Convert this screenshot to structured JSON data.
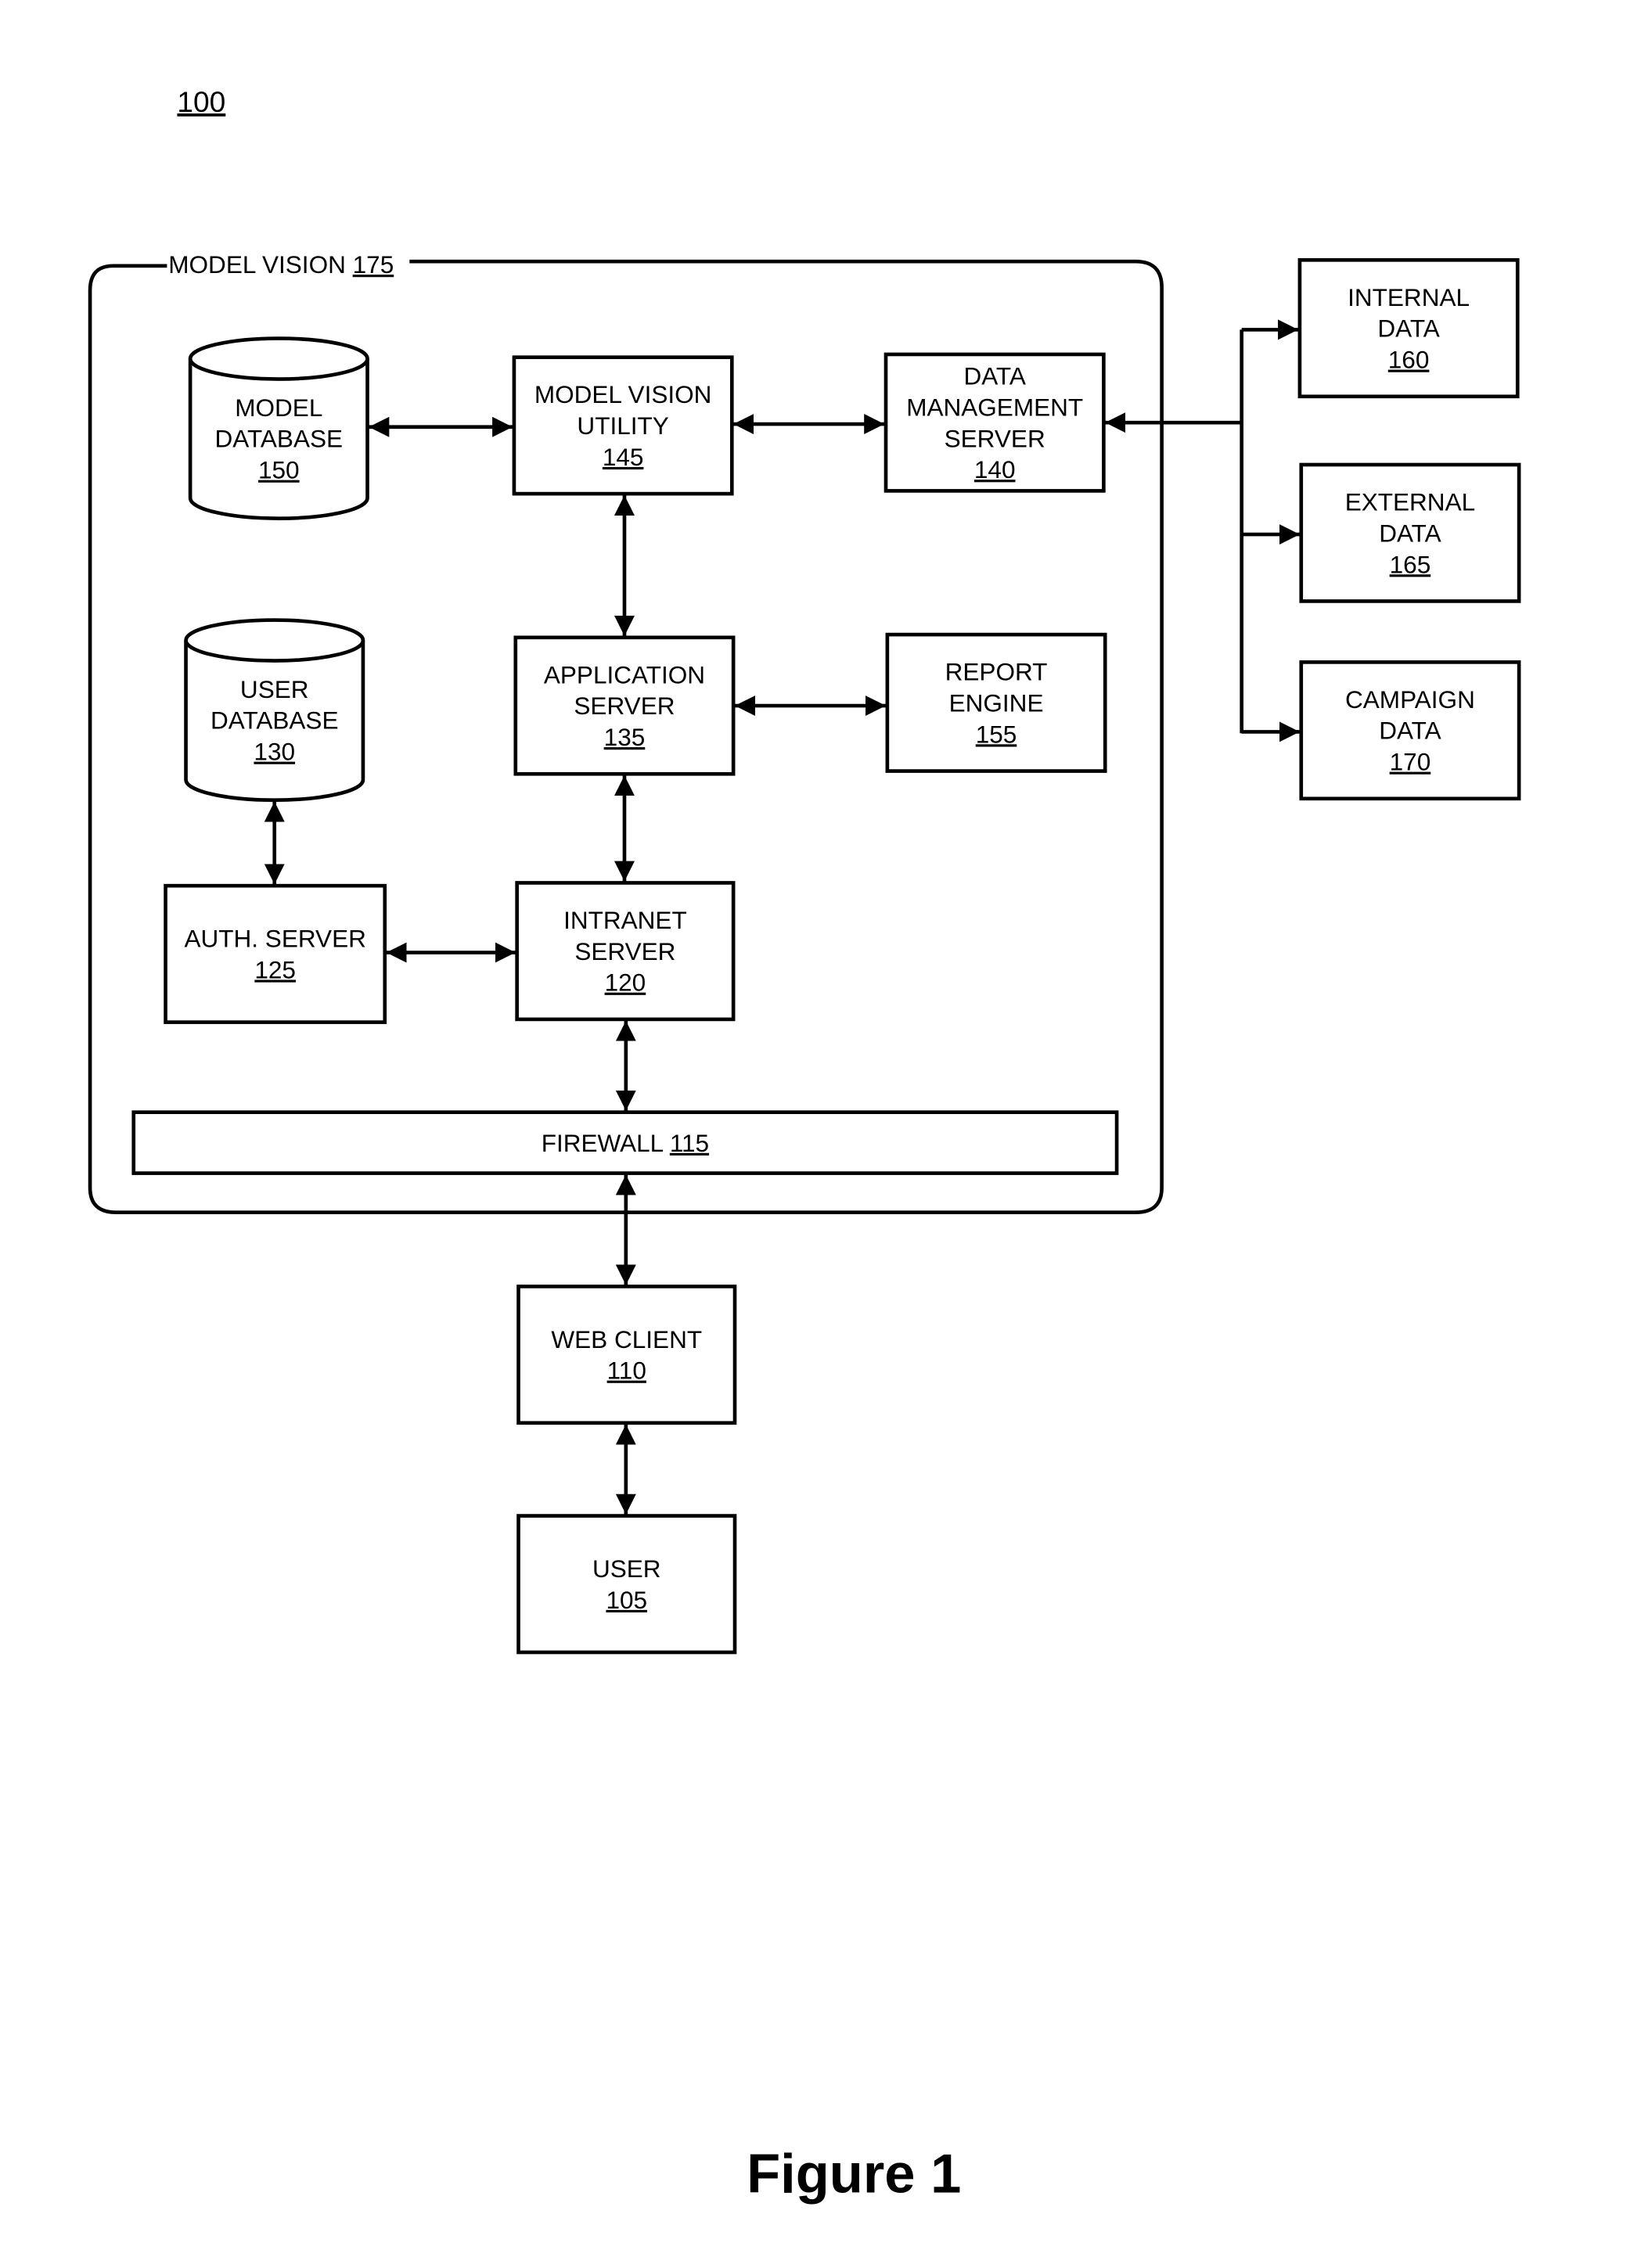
{
  "figure_number": "100",
  "figure_caption": "Figure 1",
  "container": {
    "label": "MODEL VISION",
    "ref": "175"
  },
  "nodes": {
    "model_db": {
      "lines": [
        "MODEL",
        "DATABASE"
      ],
      "ref": "150"
    },
    "mv_utility": {
      "lines": [
        "MODEL VISION",
        "UTILITY"
      ],
      "ref": "145"
    },
    "dms": {
      "lines": [
        "DATA",
        "MANAGEMENT",
        "SERVER"
      ],
      "ref": "140"
    },
    "user_db": {
      "lines": [
        "USER",
        "DATABASE"
      ],
      "ref": "130"
    },
    "app_server": {
      "lines": [
        "APPLICATION",
        "SERVER"
      ],
      "ref": "135"
    },
    "report": {
      "lines": [
        "REPORT",
        "ENGINE"
      ],
      "ref": "155"
    },
    "auth": {
      "lines": [
        "AUTH. SERVER"
      ],
      "ref": "125"
    },
    "intranet": {
      "lines": [
        "INTRANET",
        "SERVER"
      ],
      "ref": "120"
    },
    "firewall": {
      "lines": [
        "FIREWALL"
      ],
      "ref": "115"
    },
    "web_client": {
      "lines": [
        "WEB CLIENT"
      ],
      "ref": "110"
    },
    "user": {
      "lines": [
        "USER"
      ],
      "ref": "105"
    },
    "internal": {
      "lines": [
        "INTERNAL",
        "DATA"
      ],
      "ref": "160"
    },
    "external": {
      "lines": [
        "EXTERNAL",
        "DATA"
      ],
      "ref": "165"
    },
    "campaign": {
      "lines": [
        "CAMPAIGN",
        "DATA"
      ],
      "ref": "170"
    }
  }
}
